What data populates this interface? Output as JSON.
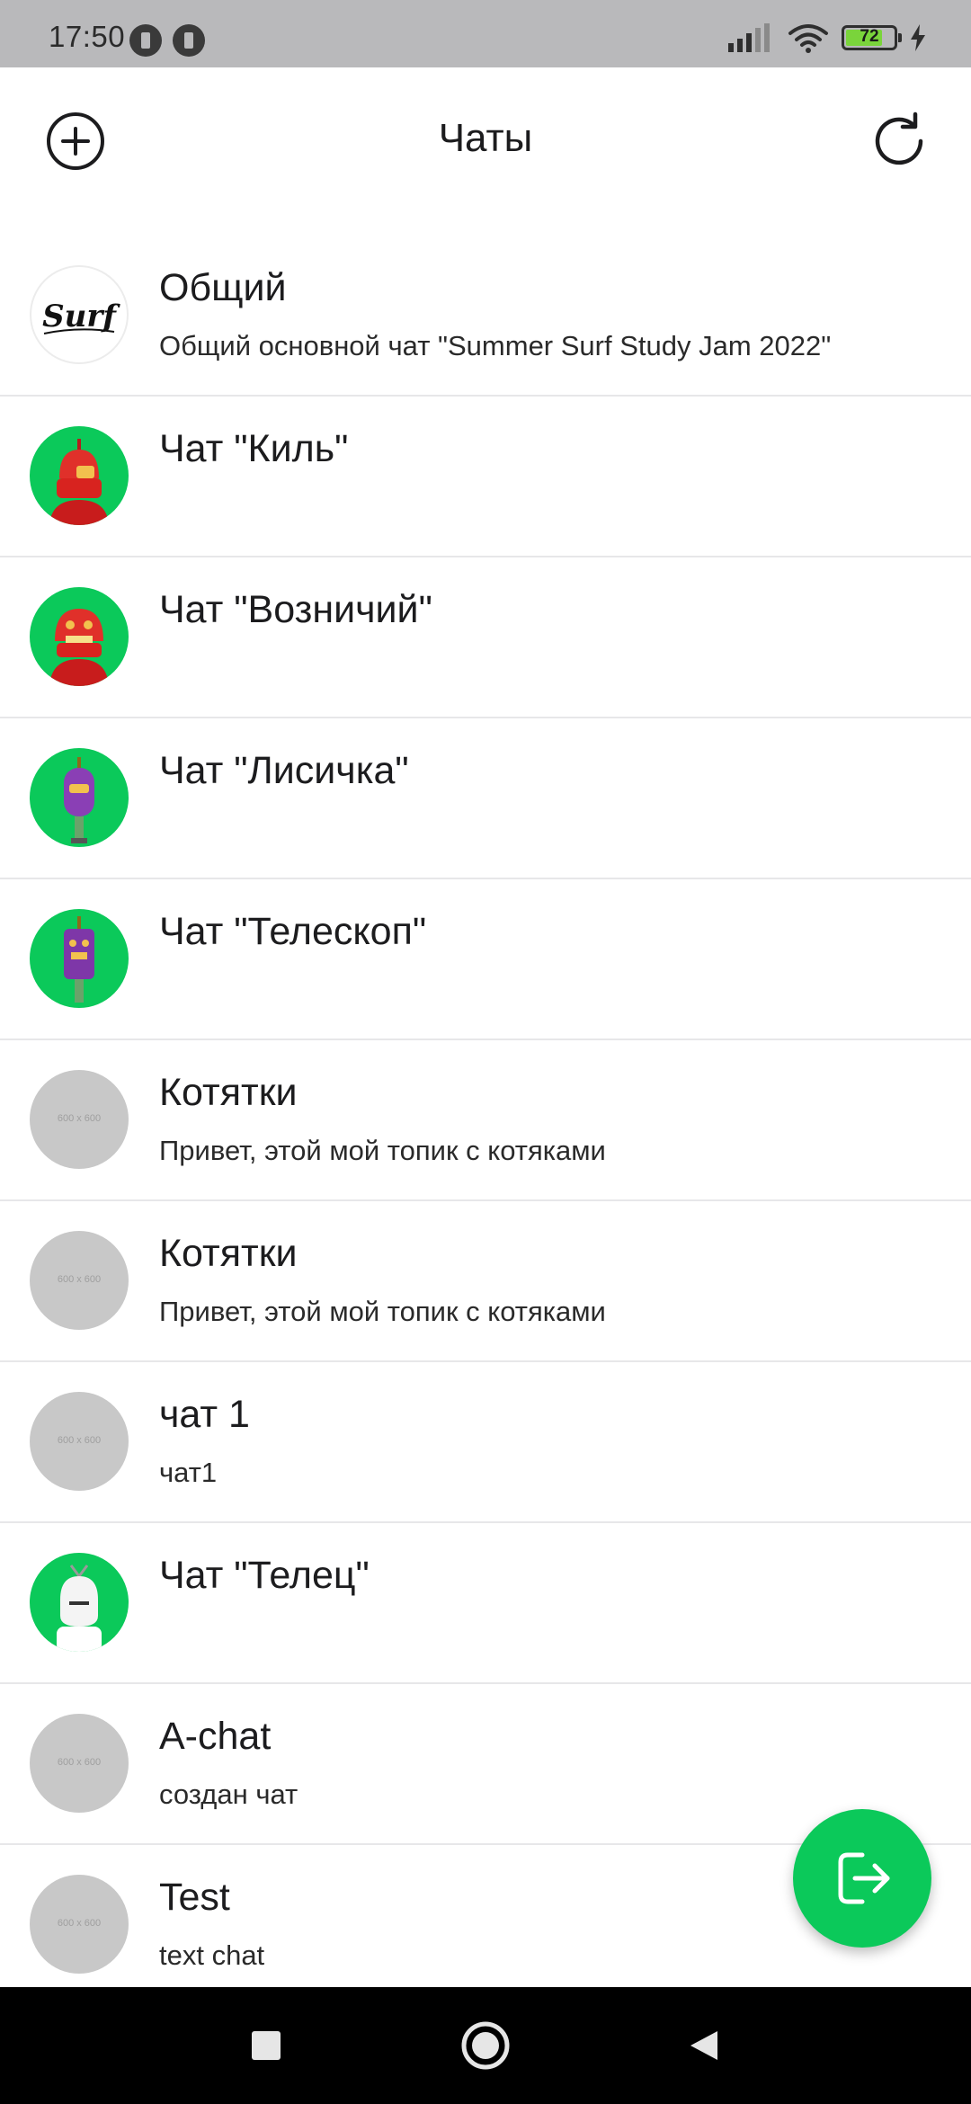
{
  "status_bar": {
    "time": "17:50",
    "battery": "72"
  },
  "app_bar": {
    "title": "Чаты",
    "add_icon": "plus-circle-icon",
    "refresh_icon": "refresh-icon"
  },
  "chats": [
    {
      "title": "Общий",
      "subtitle": "Общий основной чат \"Summer Surf Study Jam 2022\"",
      "avatar": "surf-logo",
      "avatar_text": "Surf"
    },
    {
      "title": "Чат \"Киль\"",
      "subtitle": "",
      "avatar": "robot-red"
    },
    {
      "title": "Чат \"Возничий\"",
      "subtitle": "",
      "avatar": "robot-red"
    },
    {
      "title": "Чат \"Лисичка\"",
      "subtitle": "",
      "avatar": "robot-purple"
    },
    {
      "title": "Чат \"Телескоп\"",
      "subtitle": "",
      "avatar": "robot-purple"
    },
    {
      "title": "Котятки",
      "subtitle": "Привет, этой мой топик с котяками",
      "avatar": "placeholder",
      "avatar_text": "600 x 600"
    },
    {
      "title": "Котятки",
      "subtitle": "Привет, этой мой топик с котяками",
      "avatar": "placeholder",
      "avatar_text": "600 x 600"
    },
    {
      "title": "чат 1",
      "subtitle": "чат1",
      "avatar": "placeholder",
      "avatar_text": "600 x 600"
    },
    {
      "title": "Чат \"Телец\"",
      "subtitle": "",
      "avatar": "robot-white"
    },
    {
      "title": "A-chat",
      "subtitle": "создан чат",
      "avatar": "placeholder",
      "avatar_text": "600 x 600"
    },
    {
      "title": "Test",
      "subtitle": "text chat",
      "avatar": "placeholder",
      "avatar_text": "600 x 600"
    }
  ],
  "fab": {
    "icon": "logout-icon"
  },
  "nav_bar": {
    "recents_icon": "square-icon",
    "home_icon": "circle-icon",
    "back_icon": "triangle-back-icon"
  },
  "colors": {
    "accent": "#0bc95a",
    "status_bar": "#b9b9bb",
    "divider": "#e7e7e9",
    "placeholder": "#c8c8c8"
  }
}
